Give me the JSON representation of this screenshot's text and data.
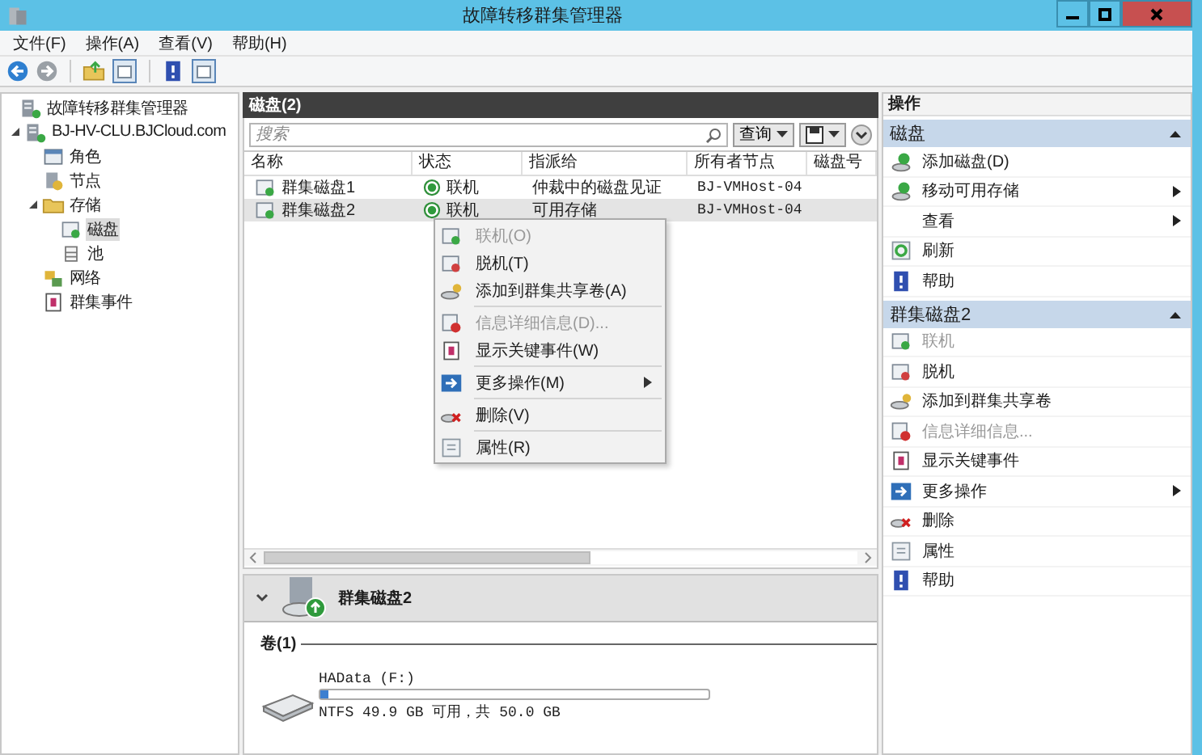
{
  "window": {
    "title": "故障转移群集管理器"
  },
  "menu": [
    "文件(F)",
    "操作(A)",
    "查看(V)",
    "帮助(H)"
  ],
  "tree": [
    {
      "label": "故障转移群集管理器",
      "selected": false,
      "children": [
        {
          "label": "BJ-HV-CLU.BJCloud.com",
          "selected": false,
          "expanded": true,
          "children": [
            {
              "label": "角色",
              "selected": false
            },
            {
              "label": "节点",
              "selected": false
            },
            {
              "label": "存储",
              "selected": false,
              "expanded": true,
              "children": [
                {
                  "label": "磁盘",
                  "selected": true
                },
                {
                  "label": "池",
                  "selected": false
                }
              ]
            },
            {
              "label": "网络",
              "selected": false
            },
            {
              "label": "群集事件",
              "selected": false
            }
          ]
        }
      ]
    }
  ],
  "center": {
    "title": "磁盘(2)",
    "search": {
      "placeholder": "搜索"
    },
    "query_button": "查询",
    "columns": [
      "名称",
      "状态",
      "指派给",
      "所有者节点",
      "磁盘号"
    ],
    "rows": [
      {
        "name": "群集磁盘1",
        "status": "联机",
        "assigned": "仲裁中的磁盘见证",
        "owner": "BJ-VMHost-04",
        "selected": false
      },
      {
        "name": "群集磁盘2",
        "status": "联机",
        "assigned": "可用存储",
        "owner": "BJ-VMHost-04",
        "selected": true
      }
    ]
  },
  "context_menu": [
    {
      "kind": "item",
      "label": "联机(O)",
      "disabled": true,
      "submenu": false
    },
    {
      "kind": "item",
      "label": "脱机(T)",
      "disabled": false,
      "submenu": false
    },
    {
      "kind": "item",
      "label": "添加到群集共享卷(A)",
      "disabled": false,
      "submenu": false
    },
    {
      "kind": "separator"
    },
    {
      "kind": "item",
      "label": "信息详细信息(D)...",
      "disabled": true,
      "submenu": false
    },
    {
      "kind": "item",
      "label": "显示关键事件(W)",
      "disabled": false,
      "submenu": false
    },
    {
      "kind": "separator"
    },
    {
      "kind": "item",
      "label": "更多操作(M)",
      "disabled": false,
      "submenu": true
    },
    {
      "kind": "separator"
    },
    {
      "kind": "item",
      "label": "删除(V)",
      "disabled": false,
      "submenu": false
    },
    {
      "kind": "separator"
    },
    {
      "kind": "item",
      "label": "属性(R)",
      "disabled": false,
      "submenu": false
    }
  ],
  "details": {
    "title": "群集磁盘2",
    "expanded": true,
    "volumes_heading": "卷(1)",
    "volume": {
      "name": "HAData (F:)",
      "level": 0.02,
      "summary": "NTFS 49.9 GB 可用，共 50.0 GB"
    }
  },
  "actions": {
    "title": "操作",
    "sections": [
      {
        "title": "磁盘",
        "expanded": true,
        "items": [
          {
            "label": "添加磁盘(D)",
            "disabled": false,
            "submenu": false
          },
          {
            "label": "移动可用存储",
            "disabled": false,
            "submenu": true
          },
          {
            "label": "查看",
            "disabled": false,
            "submenu": true
          },
          {
            "label": "刷新",
            "disabled": false,
            "submenu": false
          },
          {
            "label": "帮助",
            "disabled": false,
            "submenu": false
          }
        ]
      },
      {
        "title": "群集磁盘2",
        "expanded": true,
        "items": [
          {
            "label": "联机",
            "disabled": true,
            "submenu": false
          },
          {
            "label": "脱机",
            "disabled": false,
            "submenu": false
          },
          {
            "label": "添加到群集共享卷",
            "disabled": false,
            "submenu": false
          },
          {
            "label": "信息详细信息...",
            "disabled": true,
            "submenu": false
          },
          {
            "label": "显示关键事件",
            "disabled": false,
            "submenu": false
          },
          {
            "label": "更多操作",
            "disabled": false,
            "submenu": true
          },
          {
            "label": "删除",
            "disabled": false,
            "submenu": false
          },
          {
            "label": "属性",
            "disabled": false,
            "submenu": false
          },
          {
            "label": "帮助",
            "disabled": false,
            "submenu": false
          }
        ]
      }
    ]
  }
}
